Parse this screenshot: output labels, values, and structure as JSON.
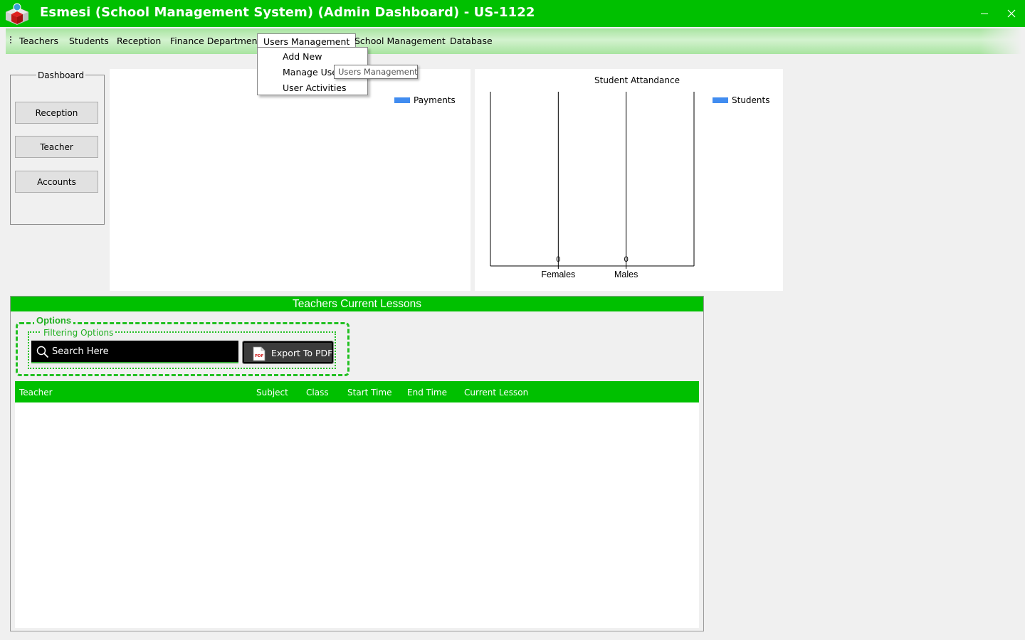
{
  "window": {
    "title": "Esmesi (School Management System) (Admin Dashboard) - US-1122"
  },
  "menu": {
    "items": [
      "Teachers",
      "Students",
      "Reception",
      "Finance Department",
      "Users Management",
      "School Management",
      "Database"
    ],
    "open_menu": "Users Management",
    "dropdown": [
      "Add New",
      "Manage Users",
      "User Activities"
    ],
    "dropdown_visible": [
      "Add New",
      "Manage Use",
      "User Activities"
    ],
    "tooltip": "Users Management"
  },
  "dashboard": {
    "group_title": "Dashboard",
    "buttons": [
      "Reception",
      "Teacher",
      "Accounts"
    ]
  },
  "payments_chart": {
    "legend": "Payments"
  },
  "chart_data": {
    "type": "bar",
    "title": "Student Attandance",
    "categories": [
      "Females",
      "Males"
    ],
    "series": [
      {
        "name": "Students",
        "values": [
          0,
          0
        ]
      }
    ],
    "data_labels": [
      "0",
      "0"
    ],
    "legend": "top-right",
    "grid": true
  },
  "lessons": {
    "header": "Teachers Current Lessons",
    "options_label": "Options",
    "filter_label": "Filtering Options",
    "search_placeholder": "Search Here",
    "export_label": "Export To PDF",
    "pdf_icon_text": "PDF",
    "columns": [
      "Teacher",
      "Subject",
      "Class",
      "Start Time",
      "End Time",
      "Current Lesson"
    ]
  },
  "colors": {
    "accent": "#00c000",
    "legend_blue": "#418cf0"
  }
}
